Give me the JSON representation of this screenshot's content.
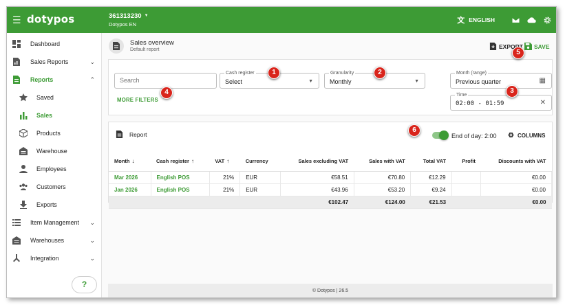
{
  "topbar": {
    "logo": "dotypos",
    "account_id": "361313230",
    "account_name": "Dotypos EN",
    "language": "ENGLISH"
  },
  "sidebar": {
    "items": [
      {
        "label": "Dashboard"
      },
      {
        "label": "Sales Reports"
      },
      {
        "label": "Reports"
      },
      {
        "label": "Saved"
      },
      {
        "label": "Sales"
      },
      {
        "label": "Products"
      },
      {
        "label": "Warehouse"
      },
      {
        "label": "Employees"
      },
      {
        "label": "Customers"
      },
      {
        "label": "Exports"
      },
      {
        "label": "Item Management"
      },
      {
        "label": "Warehouses"
      },
      {
        "label": "Integration"
      }
    ],
    "help": "?"
  },
  "header": {
    "title": "Sales overview",
    "subtitle": "Default report",
    "export_label": "EXPORT",
    "save_label": "SAVE"
  },
  "filters": {
    "search_placeholder": "Search",
    "cash_register_label": "Cash register",
    "cash_register_value": "Select",
    "granularity_label": "Granularity",
    "granularity_value": "Monthly",
    "month_label": "Month (range)",
    "month_value": "Previous quarter",
    "time_label": "Time",
    "time_value": "02:00 - 01:59",
    "more_filters": "MORE FILTERS"
  },
  "report": {
    "title": "Report",
    "end_of_day": "End of day: 2:00",
    "columns_label": "COLUMNS",
    "headers": [
      "Month",
      "Cash register",
      "VAT",
      "Currency",
      "Sales excluding VAT",
      "Sales with VAT",
      "Total VAT",
      "Profit",
      "Discounts with VAT"
    ],
    "rows": [
      [
        "Mar 2026",
        "English POS",
        "21%",
        "EUR",
        "€58.51",
        "€70.80",
        "€12.29",
        "",
        "€0.00"
      ],
      [
        "Jan 2026",
        "English POS",
        "21%",
        "EUR",
        "€43.96",
        "€53.20",
        "€9.24",
        "",
        "€0.00"
      ]
    ],
    "totals": [
      "",
      "",
      "",
      "",
      "€102.47",
      "€124.00",
      "€21.53",
      "",
      "€0.00"
    ]
  },
  "footer": "© Dotypos  | 26.5",
  "badges": [
    "1",
    "2",
    "3",
    "4",
    "5",
    "6"
  ],
  "colors": {
    "brand": "#3d9b35",
    "badge": "#d9251c"
  }
}
